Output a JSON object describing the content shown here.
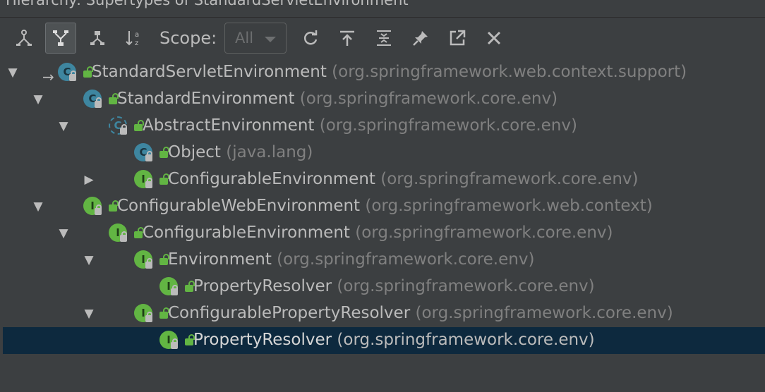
{
  "window": {
    "title": "Hierarchy:  Supertypes of StandardServletEnvironment"
  },
  "toolbar": {
    "buttons": [
      {
        "icon": "subtypes-hierarchy-icon"
      },
      {
        "icon": "supertypes-hierarchy-icon",
        "active": true
      },
      {
        "icon": "class-hierarchy-icon"
      },
      {
        "icon": "sort-alphabetically-icon"
      },
      {
        "icon": "refresh-icon"
      },
      {
        "icon": "export-icon"
      },
      {
        "icon": "expand-all-icon"
      },
      {
        "icon": "pin-icon"
      },
      {
        "icon": "open-in-new-icon"
      },
      {
        "icon": "close-icon"
      }
    ],
    "scope_label": "Scope:",
    "scope_value": "All"
  },
  "tree": {
    "rows": [
      {
        "depth": 0,
        "toggle": "▼",
        "kind": "class",
        "name": "StandardServletEnvironment",
        "pkg": "(org.springframework.web.context.support)",
        "current": true
      },
      {
        "depth": 1,
        "toggle": "▼",
        "kind": "class",
        "name": "StandardEnvironment",
        "pkg": "(org.springframework.core.env)"
      },
      {
        "depth": 2,
        "toggle": "▼",
        "kind": "abstract",
        "name": "AbstractEnvironment",
        "pkg": "(org.springframework.core.env)"
      },
      {
        "depth": 3,
        "toggle": "",
        "kind": "class",
        "name": "Object",
        "pkg": "(java.lang)"
      },
      {
        "depth": 3,
        "toggle": "▶",
        "kind": "iface",
        "name": "ConfigurableEnvironment",
        "pkg": "(org.springframework.core.env)"
      },
      {
        "depth": 1,
        "toggle": "▼",
        "kind": "iface",
        "name": "ConfigurableWebEnvironment",
        "pkg": "(org.springframework.web.context)"
      },
      {
        "depth": 2,
        "toggle": "▼",
        "kind": "iface",
        "name": "ConfigurableEnvironment",
        "pkg": "(org.springframework.core.env)"
      },
      {
        "depth": 3,
        "toggle": "▼",
        "kind": "iface",
        "name": "Environment",
        "pkg": "(org.springframework.core.env)"
      },
      {
        "depth": 4,
        "toggle": "",
        "kind": "iface",
        "name": "PropertyResolver",
        "pkg": "(org.springframework.core.env)"
      },
      {
        "depth": 3,
        "toggle": "▼",
        "kind": "iface",
        "name": "ConfigurablePropertyResolver",
        "pkg": "(org.springframework.core.env)"
      },
      {
        "depth": 4,
        "toggle": "",
        "kind": "iface",
        "name": "PropertyResolver",
        "pkg": "(org.springframework.core.env)",
        "selected": true
      }
    ]
  },
  "colors": {
    "background": "#3c3f41",
    "selection": "#0d293e",
    "class_icon": "#3e86a0",
    "interface_icon": "#62b543",
    "text": "#bbbbbb",
    "package_text": "#808080"
  }
}
